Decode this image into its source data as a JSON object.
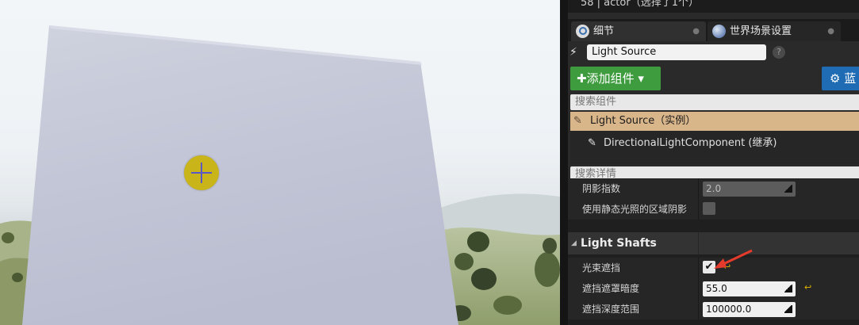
{
  "title_bar": {
    "text": "58 | actor（选择了1个）"
  },
  "tabs": [
    {
      "label": "细节",
      "icon": "magnifier-icon"
    },
    {
      "label": "世界场景设置",
      "icon": "globe-icon"
    }
  ],
  "actor": {
    "name": "Light Source",
    "icon": "light-source-icon"
  },
  "toolbar": {
    "add_component_label": "✚添加组件 ▾",
    "blueprint_label": "⚙ 蓝"
  },
  "component_search": {
    "placeholder": "搜索组件"
  },
  "components": [
    {
      "label": "Light Source（实例）",
      "icon": "light-source-icon"
    },
    {
      "label": "DirectionalLightComponent (继承)",
      "icon": "directional-light-icon"
    }
  ],
  "details_search": {
    "placeholder": "搜索详情"
  },
  "properties": {
    "shadow_exponent": {
      "label": "阴影指数",
      "value": "2.0"
    },
    "static_light_shadows": {
      "label": "使用静态光照的区域阴影",
      "checked": false
    },
    "light_shafts": {
      "category": "Light Shafts"
    },
    "light_shaft_occlusion": {
      "label": "光束遮挡",
      "checked": true
    },
    "occlusion_mask_darkness": {
      "label": "遮挡遮罩暗度",
      "value": "55.0"
    },
    "occlusion_depth_range": {
      "label": "遮挡深度范围",
      "value": "100000.0"
    }
  },
  "colors": {
    "accent_green": "#3e9b3e",
    "accent_blue": "#1f6cb4",
    "selected_row": "#d9b58a",
    "reset_arrow": "#e2b300",
    "annotation_arrow": "#e53b2c"
  }
}
